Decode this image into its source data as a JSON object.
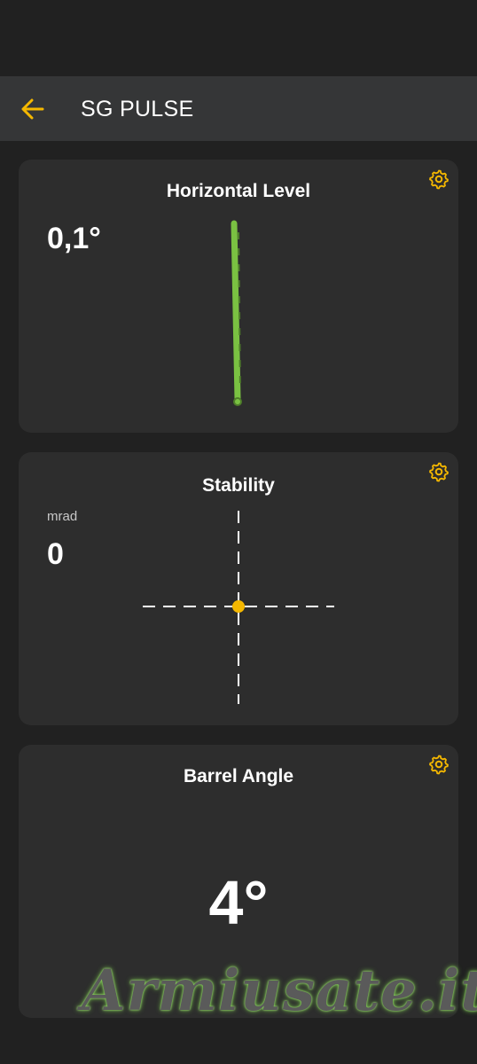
{
  "app_bar": {
    "title": "SG PULSE",
    "back_icon": "arrow-left-icon"
  },
  "colors": {
    "accent": "#f5b800",
    "level_green": "#7ac142",
    "card_bg": "#2d2d2d",
    "app_bar_bg": "#353637"
  },
  "horizontal_level": {
    "title": "Horizontal Level",
    "value": "0,1°",
    "settings_icon": "gear-icon"
  },
  "stability": {
    "title": "Stability",
    "unit": "mrad",
    "value": "0",
    "settings_icon": "gear-icon"
  },
  "barrel_angle": {
    "title": "Barrel Angle",
    "value": "4°",
    "settings_icon": "gear-icon"
  },
  "watermark": {
    "text": "Armiusate.it"
  }
}
